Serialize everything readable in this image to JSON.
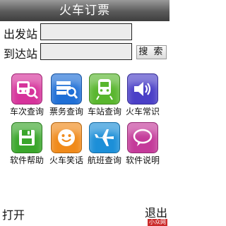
{
  "header": {
    "title": "火车订票"
  },
  "form": {
    "from_label": "出发站",
    "from_value": "",
    "to_label": "到达站",
    "to_value": "",
    "search_label": "搜 索"
  },
  "grid": {
    "items": [
      {
        "label": "车次查询",
        "icon": "train-search-icon",
        "color": "#d6339b"
      },
      {
        "label": "票务查询",
        "icon": "ticket-search-icon",
        "color": "#1f6fd6"
      },
      {
        "label": "车站查询",
        "icon": "station-train-icon",
        "color": "#59b62e"
      },
      {
        "label": "火车常识",
        "icon": "speaker-icon",
        "color": "#4a3fc7"
      },
      {
        "label": "软件帮助",
        "icon": "floppy-disk-icon",
        "color": "#3aa62b"
      },
      {
        "label": "火车笑话",
        "icon": "smiley-face-icon",
        "color": "#f08a1a"
      },
      {
        "label": "航班查询",
        "icon": "airplane-icon",
        "color": "#1c8fd8"
      },
      {
        "label": "软件说明",
        "icon": "chat-bubble-icon",
        "color": "#c43a9a"
      }
    ]
  },
  "softkeys": {
    "left": "打开",
    "right": "退出"
  },
  "watermark": "小众网"
}
